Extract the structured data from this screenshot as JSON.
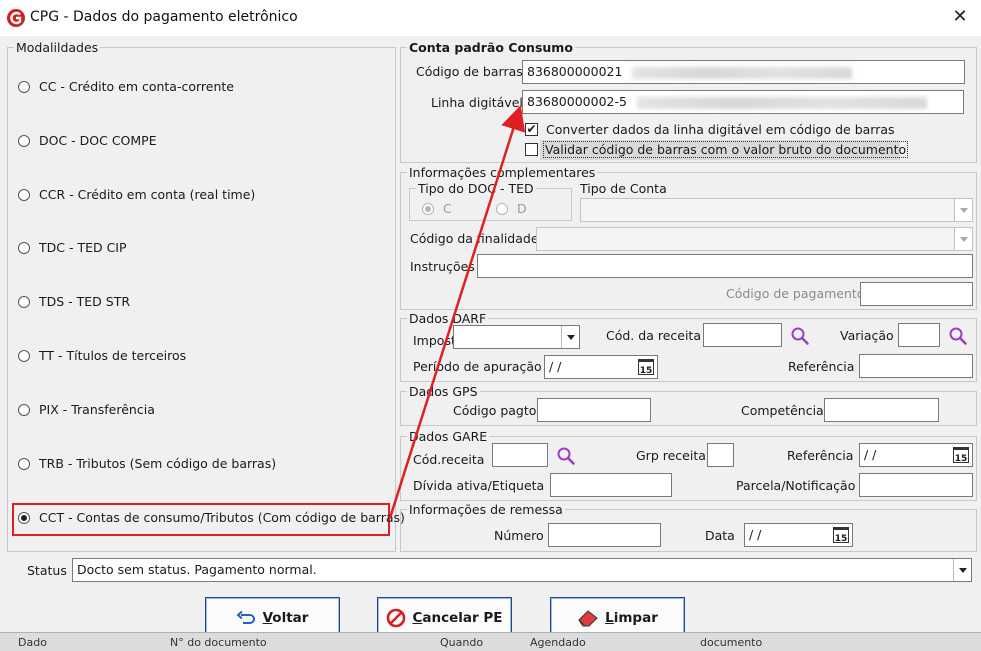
{
  "window": {
    "title": "CPG - Dados do pagamento eletrônico",
    "icons": {
      "app": "app-logo-icon",
      "close": "close-icon"
    }
  },
  "modalidades": {
    "legend": "Modalildades",
    "items": [
      {
        "label": "CC  - Crédito em conta-corrente",
        "selected": false
      },
      {
        "label": "DOC - DOC COMPE",
        "selected": false
      },
      {
        "label": "CCR - Crédito em conta (real time)",
        "selected": false
      },
      {
        "label": "TDC - TED CIP",
        "selected": false
      },
      {
        "label": "TDS - TED STR",
        "selected": false
      },
      {
        "label": "TT  - Títulos de terceiros",
        "selected": false
      },
      {
        "label": "PIX - Transferência",
        "selected": false
      },
      {
        "label": "TRB - Tributos (Sem código de barras)",
        "selected": false
      },
      {
        "label": "CCT - Contas de consumo/Tributos (Com código de barras)",
        "selected": true
      }
    ]
  },
  "conta_padrao": {
    "legend": "Conta padrão Consumo",
    "codigo_barras_label": "Código de barras",
    "codigo_barras_value": "836800000021",
    "linha_digitavel_label": "Linha digitável",
    "linha_digitavel_value": "83680000002-5",
    "converter_label": "Converter dados da linha digitável em código de barras",
    "converter_checked": true,
    "validar_label": "Validar código de barras com o valor bruto do documento",
    "validar_checked": false
  },
  "info_complementares": {
    "legend": "Informações complementares",
    "tipo_doc_legend": "Tipo do DOC - TED",
    "tipo_doc_options": [
      "C",
      "D"
    ],
    "tipo_conta_label": "Tipo de Conta",
    "tipo_conta_value": "",
    "codigo_finalidade_label": "Código da finalidade",
    "instrucoes_label": "Instruções",
    "codigo_pagamento_label": "Código de pagamento"
  },
  "dados_darf": {
    "legend": "Dados DARF",
    "imposto_label": "Imposto",
    "cod_receita_label": "Cód. da receita",
    "variacao_label": "Variação",
    "periodo_label": "Período de apuração",
    "periodo_value": " / /",
    "referencia_label": "Referência"
  },
  "dados_gps": {
    "legend": "Dados GPS",
    "codigo_pagto_label": "Código pagto",
    "competencia_label": "Competência"
  },
  "dados_gare": {
    "legend": "Dados GARE",
    "cod_receita_label": "Cód.receita",
    "grp_receita_label": "Grp receita",
    "referencia_label": "Referência",
    "referencia_value": " / /",
    "divida_label": "Dívida ativa/Etiqueta",
    "parcela_label": "Parcela/Notificação"
  },
  "remessa": {
    "legend": "Informações de remessa",
    "numero_label": "Número",
    "data_label": "Data",
    "data_value": " / /"
  },
  "status": {
    "label": "Status",
    "value": "Docto sem status. Pagamento normal."
  },
  "buttons": {
    "voltar": {
      "underlined": "V",
      "rest": "oltar"
    },
    "cancelar": {
      "underlined": "C",
      "rest": "ancelar PE"
    },
    "limpar": {
      "underlined": "L",
      "rest": "impar"
    }
  },
  "calendar_icon_text": "15",
  "bottom_strip": {
    "items": [
      "Dado",
      "N° do documento",
      "Quando",
      "Agendado",
      "documento"
    ]
  },
  "colors": {
    "annotation_red": "#e02020",
    "accent_purple": "#9b3ec8",
    "button_border": "#1c4a8a"
  }
}
